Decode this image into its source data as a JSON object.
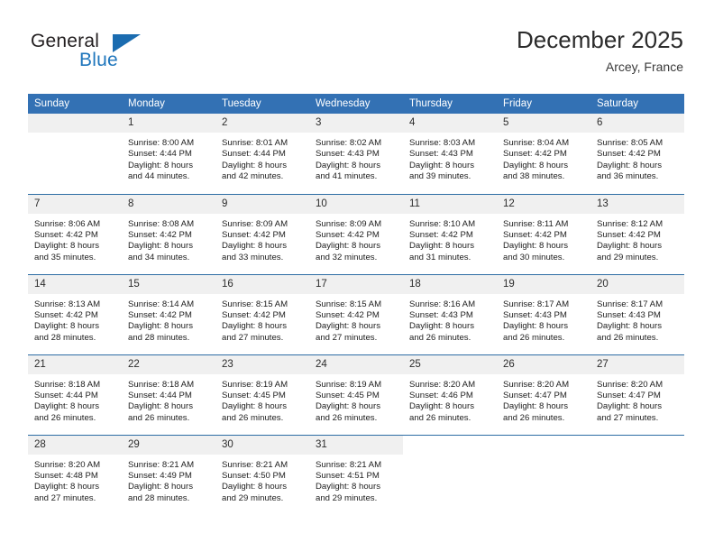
{
  "logo": {
    "word1": "General",
    "word2": "Blue",
    "triangle_color": "#1b6cb0",
    "word2_color": "#1f76bc"
  },
  "header": {
    "title": "December 2025",
    "location": "Arcey, France",
    "accent_color": "#3371b4",
    "border_color": "#2e6da4",
    "daynum_band_color": "#f0f0f0"
  },
  "weekday_headers": [
    "Sunday",
    "Monday",
    "Tuesday",
    "Wednesday",
    "Thursday",
    "Friday",
    "Saturday"
  ],
  "labels": {
    "sunrise": "Sunrise:",
    "sunset": "Sunset:",
    "daylight": "Daylight:"
  },
  "weeks": [
    [
      {
        "day": "",
        "empty": true
      },
      {
        "day": "1",
        "sunrise": "Sunrise: 8:00 AM",
        "sunset": "Sunset: 4:44 PM",
        "daylight_l1": "Daylight: 8 hours",
        "daylight_l2": "and 44 minutes."
      },
      {
        "day": "2",
        "sunrise": "Sunrise: 8:01 AM",
        "sunset": "Sunset: 4:44 PM",
        "daylight_l1": "Daylight: 8 hours",
        "daylight_l2": "and 42 minutes."
      },
      {
        "day": "3",
        "sunrise": "Sunrise: 8:02 AM",
        "sunset": "Sunset: 4:43 PM",
        "daylight_l1": "Daylight: 8 hours",
        "daylight_l2": "and 41 minutes."
      },
      {
        "day": "4",
        "sunrise": "Sunrise: 8:03 AM",
        "sunset": "Sunset: 4:43 PM",
        "daylight_l1": "Daylight: 8 hours",
        "daylight_l2": "and 39 minutes."
      },
      {
        "day": "5",
        "sunrise": "Sunrise: 8:04 AM",
        "sunset": "Sunset: 4:42 PM",
        "daylight_l1": "Daylight: 8 hours",
        "daylight_l2": "and 38 minutes."
      },
      {
        "day": "6",
        "sunrise": "Sunrise: 8:05 AM",
        "sunset": "Sunset: 4:42 PM",
        "daylight_l1": "Daylight: 8 hours",
        "daylight_l2": "and 36 minutes."
      }
    ],
    [
      {
        "day": "7",
        "sunrise": "Sunrise: 8:06 AM",
        "sunset": "Sunset: 4:42 PM",
        "daylight_l1": "Daylight: 8 hours",
        "daylight_l2": "and 35 minutes."
      },
      {
        "day": "8",
        "sunrise": "Sunrise: 8:08 AM",
        "sunset": "Sunset: 4:42 PM",
        "daylight_l1": "Daylight: 8 hours",
        "daylight_l2": "and 34 minutes."
      },
      {
        "day": "9",
        "sunrise": "Sunrise: 8:09 AM",
        "sunset": "Sunset: 4:42 PM",
        "daylight_l1": "Daylight: 8 hours",
        "daylight_l2": "and 33 minutes."
      },
      {
        "day": "10",
        "sunrise": "Sunrise: 8:09 AM",
        "sunset": "Sunset: 4:42 PM",
        "daylight_l1": "Daylight: 8 hours",
        "daylight_l2": "and 32 minutes."
      },
      {
        "day": "11",
        "sunrise": "Sunrise: 8:10 AM",
        "sunset": "Sunset: 4:42 PM",
        "daylight_l1": "Daylight: 8 hours",
        "daylight_l2": "and 31 minutes."
      },
      {
        "day": "12",
        "sunrise": "Sunrise: 8:11 AM",
        "sunset": "Sunset: 4:42 PM",
        "daylight_l1": "Daylight: 8 hours",
        "daylight_l2": "and 30 minutes."
      },
      {
        "day": "13",
        "sunrise": "Sunrise: 8:12 AM",
        "sunset": "Sunset: 4:42 PM",
        "daylight_l1": "Daylight: 8 hours",
        "daylight_l2": "and 29 minutes."
      }
    ],
    [
      {
        "day": "14",
        "sunrise": "Sunrise: 8:13 AM",
        "sunset": "Sunset: 4:42 PM",
        "daylight_l1": "Daylight: 8 hours",
        "daylight_l2": "and 28 minutes."
      },
      {
        "day": "15",
        "sunrise": "Sunrise: 8:14 AM",
        "sunset": "Sunset: 4:42 PM",
        "daylight_l1": "Daylight: 8 hours",
        "daylight_l2": "and 28 minutes."
      },
      {
        "day": "16",
        "sunrise": "Sunrise: 8:15 AM",
        "sunset": "Sunset: 4:42 PM",
        "daylight_l1": "Daylight: 8 hours",
        "daylight_l2": "and 27 minutes."
      },
      {
        "day": "17",
        "sunrise": "Sunrise: 8:15 AM",
        "sunset": "Sunset: 4:42 PM",
        "daylight_l1": "Daylight: 8 hours",
        "daylight_l2": "and 27 minutes."
      },
      {
        "day": "18",
        "sunrise": "Sunrise: 8:16 AM",
        "sunset": "Sunset: 4:43 PM",
        "daylight_l1": "Daylight: 8 hours",
        "daylight_l2": "and 26 minutes."
      },
      {
        "day": "19",
        "sunrise": "Sunrise: 8:17 AM",
        "sunset": "Sunset: 4:43 PM",
        "daylight_l1": "Daylight: 8 hours",
        "daylight_l2": "and 26 minutes."
      },
      {
        "day": "20",
        "sunrise": "Sunrise: 8:17 AM",
        "sunset": "Sunset: 4:43 PM",
        "daylight_l1": "Daylight: 8 hours",
        "daylight_l2": "and 26 minutes."
      }
    ],
    [
      {
        "day": "21",
        "sunrise": "Sunrise: 8:18 AM",
        "sunset": "Sunset: 4:44 PM",
        "daylight_l1": "Daylight: 8 hours",
        "daylight_l2": "and 26 minutes."
      },
      {
        "day": "22",
        "sunrise": "Sunrise: 8:18 AM",
        "sunset": "Sunset: 4:44 PM",
        "daylight_l1": "Daylight: 8 hours",
        "daylight_l2": "and 26 minutes."
      },
      {
        "day": "23",
        "sunrise": "Sunrise: 8:19 AM",
        "sunset": "Sunset: 4:45 PM",
        "daylight_l1": "Daylight: 8 hours",
        "daylight_l2": "and 26 minutes."
      },
      {
        "day": "24",
        "sunrise": "Sunrise: 8:19 AM",
        "sunset": "Sunset: 4:45 PM",
        "daylight_l1": "Daylight: 8 hours",
        "daylight_l2": "and 26 minutes."
      },
      {
        "day": "25",
        "sunrise": "Sunrise: 8:20 AM",
        "sunset": "Sunset: 4:46 PM",
        "daylight_l1": "Daylight: 8 hours",
        "daylight_l2": "and 26 minutes."
      },
      {
        "day": "26",
        "sunrise": "Sunrise: 8:20 AM",
        "sunset": "Sunset: 4:47 PM",
        "daylight_l1": "Daylight: 8 hours",
        "daylight_l2": "and 26 minutes."
      },
      {
        "day": "27",
        "sunrise": "Sunrise: 8:20 AM",
        "sunset": "Sunset: 4:47 PM",
        "daylight_l1": "Daylight: 8 hours",
        "daylight_l2": "and 27 minutes."
      }
    ],
    [
      {
        "day": "28",
        "sunrise": "Sunrise: 8:20 AM",
        "sunset": "Sunset: 4:48 PM",
        "daylight_l1": "Daylight: 8 hours",
        "daylight_l2": "and 27 minutes."
      },
      {
        "day": "29",
        "sunrise": "Sunrise: 8:21 AM",
        "sunset": "Sunset: 4:49 PM",
        "daylight_l1": "Daylight: 8 hours",
        "daylight_l2": "and 28 minutes."
      },
      {
        "day": "30",
        "sunrise": "Sunrise: 8:21 AM",
        "sunset": "Sunset: 4:50 PM",
        "daylight_l1": "Daylight: 8 hours",
        "daylight_l2": "and 29 minutes."
      },
      {
        "day": "31",
        "sunrise": "Sunrise: 8:21 AM",
        "sunset": "Sunset: 4:51 PM",
        "daylight_l1": "Daylight: 8 hours",
        "daylight_l2": "and 29 minutes."
      },
      {
        "day": "",
        "empty": true,
        "no_band": true
      },
      {
        "day": "",
        "empty": true,
        "no_band": true
      },
      {
        "day": "",
        "empty": true,
        "no_band": true
      }
    ]
  ]
}
